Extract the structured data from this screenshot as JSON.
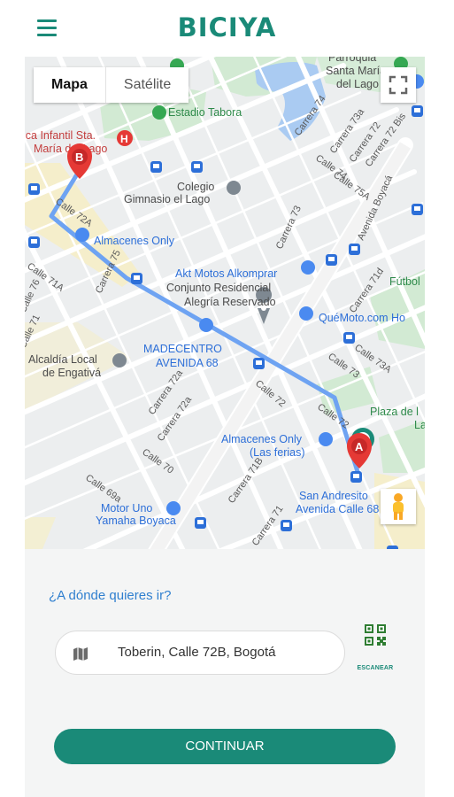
{
  "header": {
    "brand": "BICIYA",
    "menu_icon": "hamburger-menu-icon"
  },
  "map": {
    "map_type": {
      "map_label": "Mapa",
      "satellite_label": "Satélite",
      "selected": "Mapa"
    },
    "places": {
      "hospital": "ica Infantil Sta.",
      "hospital2": "María del Lago",
      "estadio": "Estadio Tabora",
      "colegio": "Colegio",
      "colegio2": "Gimnasio el Lago",
      "almacenes_only": "Almacenes Only",
      "akt": "Akt Motos Alkomprar",
      "conjunto": "Conjunto Residencial",
      "alegria": "Alegría Reservado",
      "quemoto": "QuéMoto.com Ho",
      "madecentro": "MADECENTRO",
      "madecentro2": "AVENIDA 68",
      "alcaldia": "Alcaldía Local",
      "alcaldia2": "de Engativá",
      "almacenes_ferias": "Almacenes Only",
      "almacenes_ferias2": "(Las ferias)",
      "plaza": "Plaza de l",
      "plaza2": "La",
      "sanandresito": "San Andresito",
      "sanandresito2": "Avenida Calle 68",
      "motouno": "Motor Uno",
      "motouno2": "Yamaha Boyaca",
      "parroquia": "Parroquia",
      "parroquia2": "Santa María",
      "parroquia3": "del Lago",
      "futbol": "Fútbol"
    },
    "streets": {
      "calle72a": "Calle 72A",
      "calle71a": "Calle 71A",
      "carrera75": "Carrera 75",
      "calle76": "Calle 76",
      "carrera73": "Carrera 73",
      "carrera74": "Carrera 74",
      "carrera73a": "Carrera 73a",
      "carrera72": "Carrera 72",
      "carrera72bis": "Carrera 72 Bis",
      "calle75a": "Calle 75A",
      "calle74": "Calle 74",
      "avenida_boyaca": "Avenida Boyacá",
      "calle73a": "Calle 73A",
      "calle73": "Calle 73",
      "carrera71d": "Carrera 71d",
      "carrera72a": "Carrera 72a",
      "calle72": "Calle 72",
      "calle70": "Calle 70",
      "carrera72a2": "Carrera 72a",
      "calle69a": "Calle 69a",
      "carrera71b": "Carrera 71B",
      "carrera71": "Carrera 71",
      "calle72b": "Calle 72",
      "calle71": "Calle 71"
    },
    "markers": {
      "origin": "A",
      "destination": "B"
    },
    "route_color": "#6ea3f2"
  },
  "form": {
    "question": "¿A dónde quieres ir?",
    "destination_value": "Toberin, Calle 72B, Bogotá",
    "scan_label": "ESCANEAR",
    "continue_label": "CONTINUAR"
  },
  "colors": {
    "brand": "#1a8a78",
    "link": "#2f7fcf",
    "marker": "#e53935"
  }
}
